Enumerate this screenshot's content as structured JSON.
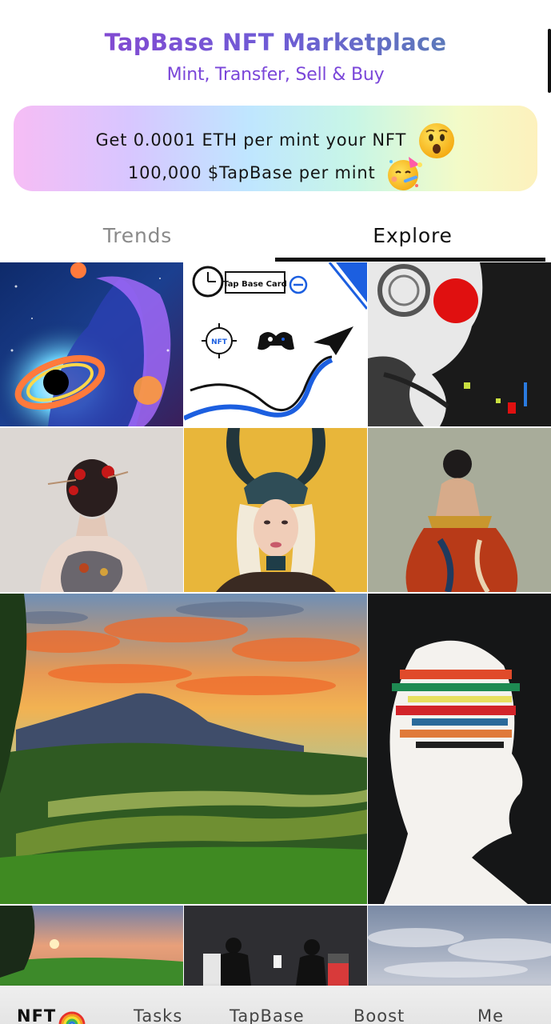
{
  "header": {
    "title": "TapBase NFT Marketplace",
    "subtitle": "Mint, Transfer, Sell & Buy"
  },
  "banner": {
    "line1": "Get 0.0001 ETH per mint your NFT",
    "line1_icon": "astonished-face-emoji",
    "line2": "100,000 $TapBase per mint",
    "line2_icon": "party-face-emoji"
  },
  "tabs": [
    {
      "label": "Trends",
      "active": false
    },
    {
      "label": "Explore",
      "active": true
    }
  ],
  "gallery": {
    "tiles": [
      {
        "name": "nft-cosmic-woman"
      },
      {
        "name": "nft-tapbase-card",
        "label": "Tap Base Card",
        "badge": "NFT"
      },
      {
        "name": "nft-abstract-red-sun"
      },
      {
        "name": "nft-geisha-back"
      },
      {
        "name": "nft-viking-helmet-woman"
      },
      {
        "name": "nft-kimono-woman"
      },
      {
        "name": "nft-mountain-rice-terrace"
      },
      {
        "name": "nft-glitch-head"
      },
      {
        "name": "nft-sunset-field"
      },
      {
        "name": "nft-silhouette-delivery"
      },
      {
        "name": "nft-cloudy-sky"
      }
    ]
  },
  "bottom_nav": {
    "items": [
      {
        "label": "NFT",
        "active": true,
        "icon": "rainbow-icon"
      },
      {
        "label": "Tasks",
        "active": false
      },
      {
        "label": "TapBase",
        "active": false
      },
      {
        "label": "Boost",
        "active": false
      },
      {
        "label": "Me",
        "active": false
      }
    ]
  },
  "colors": {
    "title_gradient_start": "#8d3fcf",
    "title_gradient_end": "#4f8aa8",
    "subtitle": "#7a46d9",
    "tab_active": "#111111",
    "tab_inactive": "#8a8a8a"
  }
}
